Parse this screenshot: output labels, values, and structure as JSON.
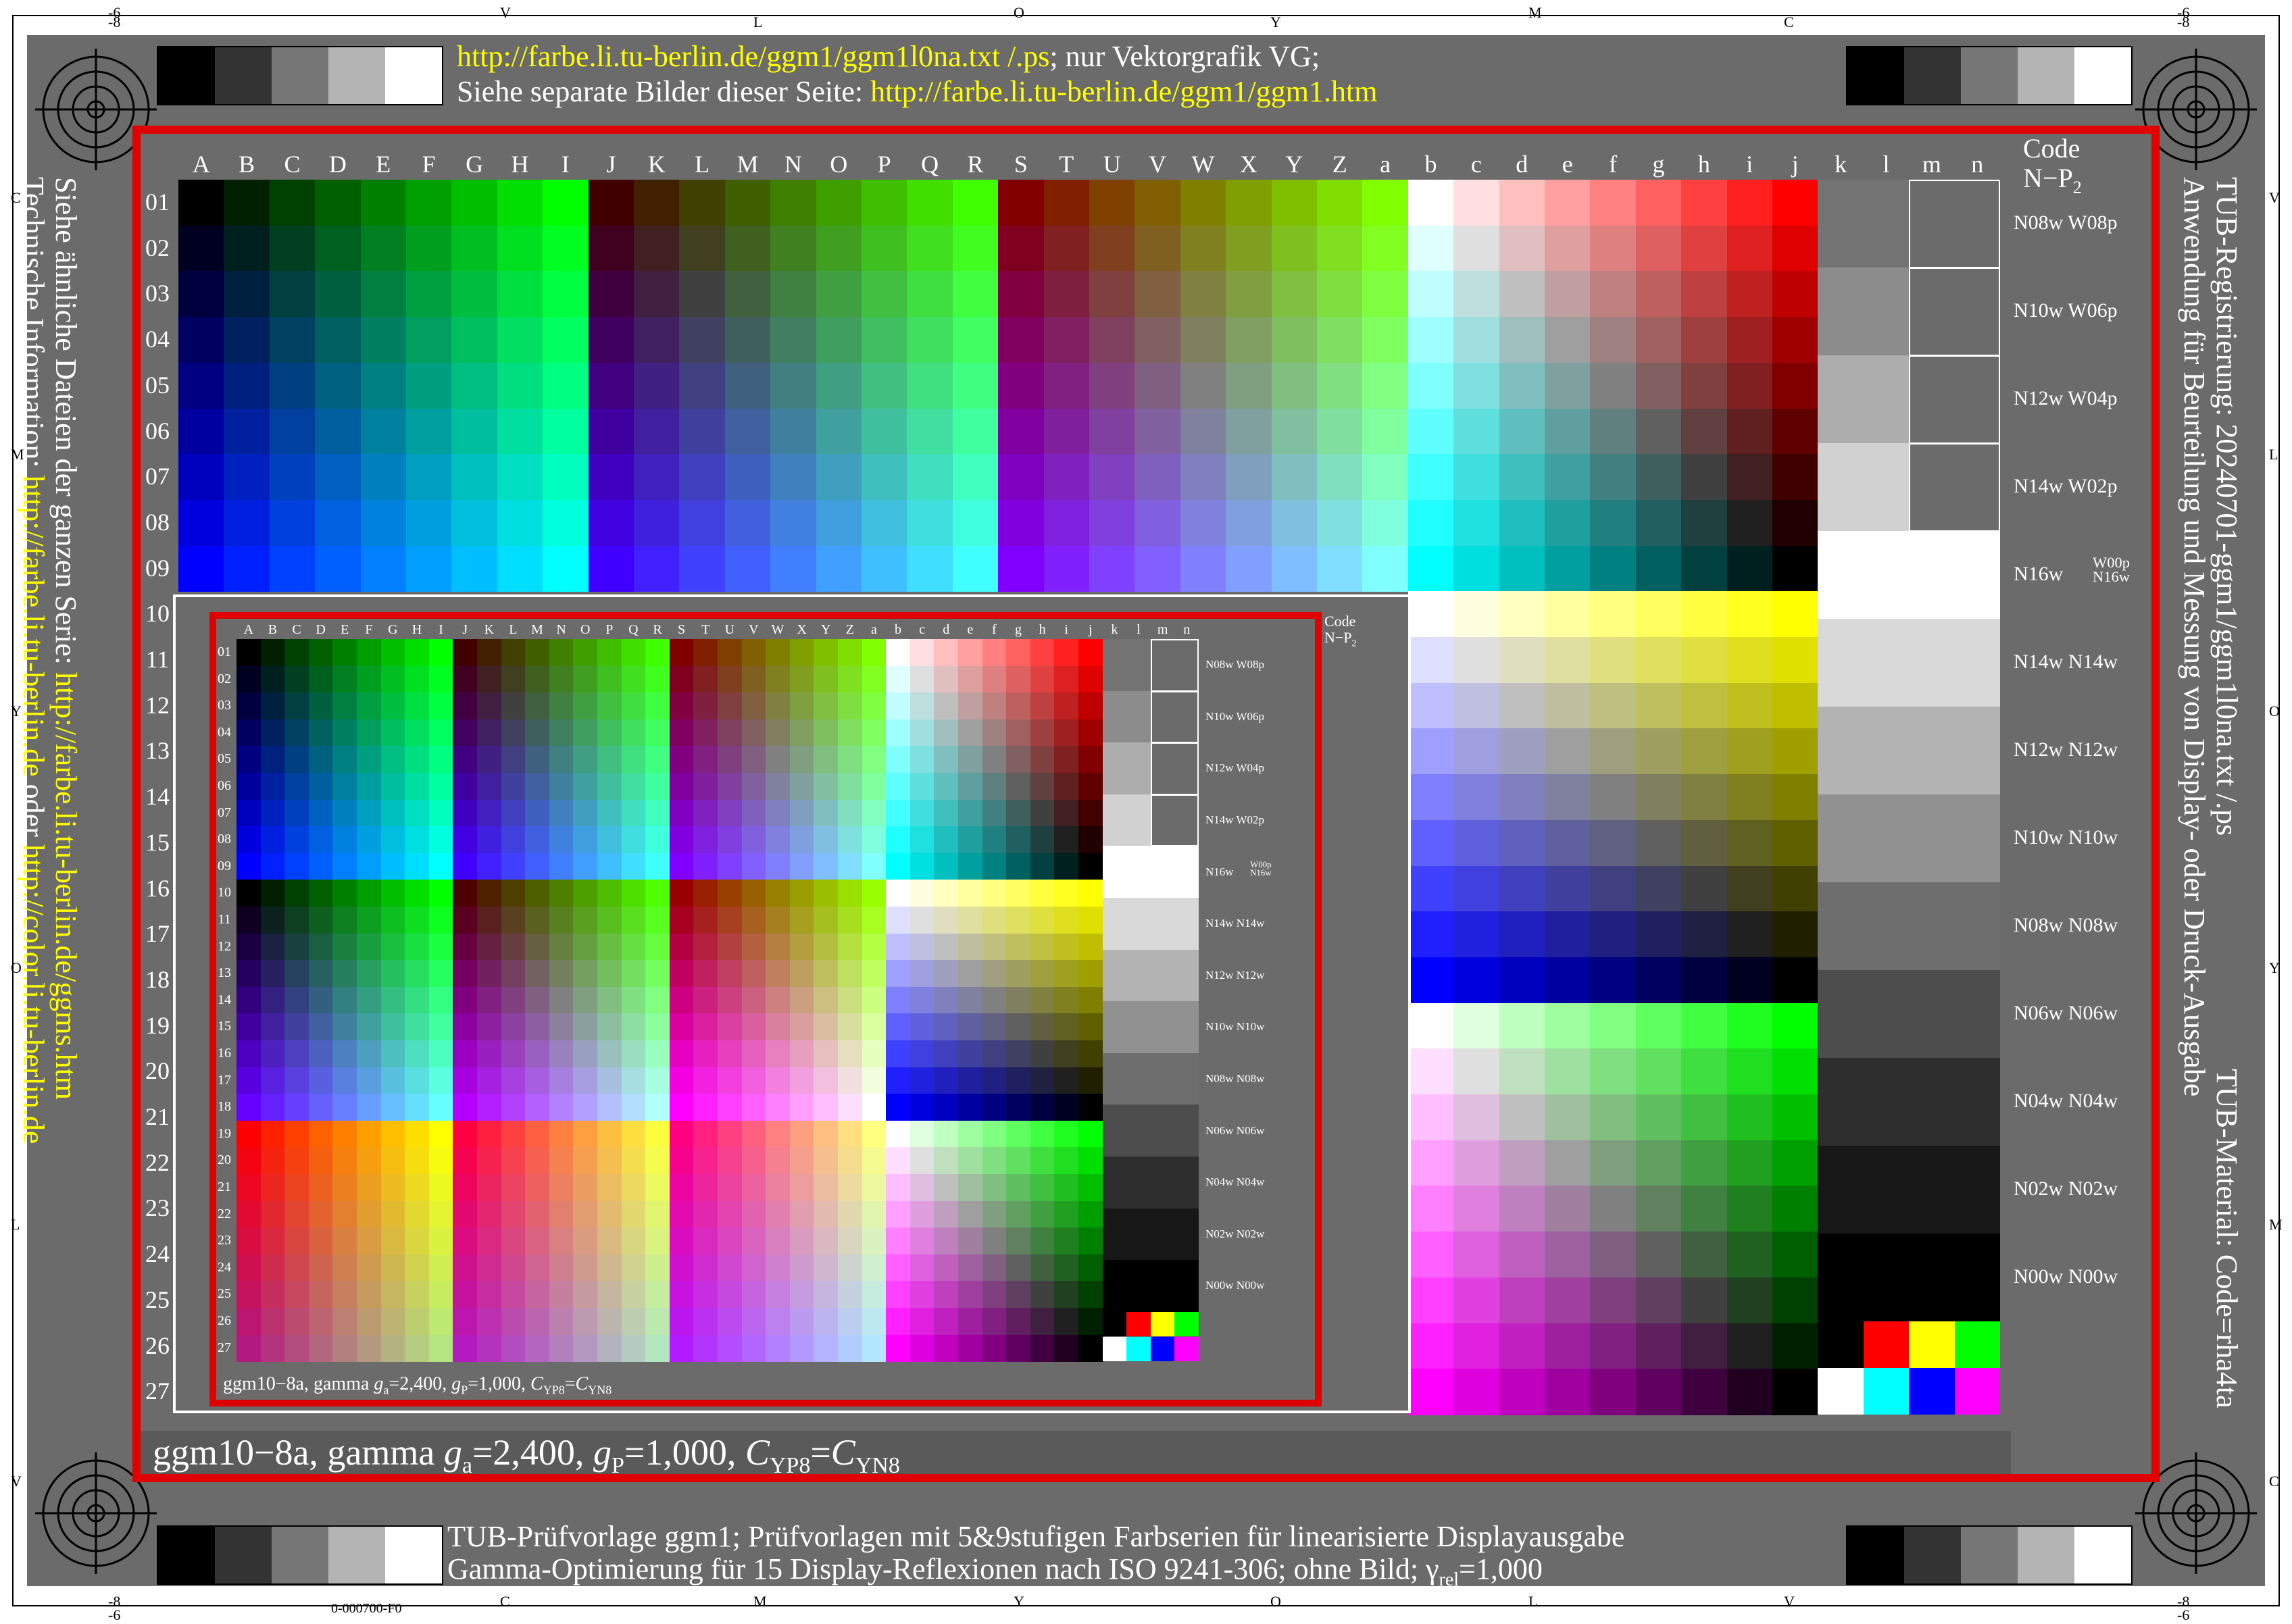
{
  "page": {
    "frame_code": "0-000700-F0"
  },
  "edge_markers": {
    "top": [
      "-6",
      "-8",
      "V",
      "L",
      "O",
      "Y",
      "M",
      "C",
      "-8",
      "-6"
    ],
    "bottom": [
      "-6",
      "-8",
      "C",
      "M",
      "Y",
      "O",
      "L",
      "V",
      "-8",
      "-6"
    ],
    "left": [
      "C",
      "M",
      "Y",
      "O",
      "L",
      "V"
    ],
    "right": [
      "V",
      "L",
      "O",
      "Y",
      "M",
      "C"
    ]
  },
  "header": {
    "line1_link": "http://farbe.li.tu-berlin.de/ggm1/ggm1l0na.txt /.ps",
    "line1_text": "; nur Vektorgrafik VG;",
    "line2_text": "Siehe separate Bilder dieser Seite: ",
    "line2_link": "http://farbe.li.tu-berlin.de/ggm1/ggm1.htm"
  },
  "footer": {
    "line1": "TUB-Prüfvorlage ggm1; Prüfvorlagen mit 5&9stufigen Farbserien für linearisierte Displayausgabe",
    "line2_main": "Gamma-Optimierung für 15 Display-Reflexionen nach ISO 9241-306; ohne Bild; γ",
    "line2_sub": "rel",
    "line2_end": "=1,000"
  },
  "left_side": {
    "line1_text": "Siehe ähnliche Dateien der ganzen Serie: ",
    "line1_link": "http://farbe.li.tu-berlin.de/ggms.htm",
    "line2_text": "Technische Information: ",
    "line2_link1": "http://farbe.li.tu-berlin.de",
    "line2_mid": " oder ",
    "line2_link2": "http://color.li.tu-berlin.de"
  },
  "right_side": {
    "line1": "TUB-Registrierung: 20240701-ggm1/ggm1l0na.txt /.ps",
    "line2": "Anwendung für Beurteilung und Messung von Display- oder Druck-Ausgabe",
    "line3": "TUB-Material: Code=rha4ta"
  },
  "chart": {
    "columns": [
      "A",
      "B",
      "C",
      "D",
      "E",
      "F",
      "G",
      "H",
      "I",
      "J",
      "K",
      "L",
      "M",
      "N",
      "O",
      "P",
      "Q",
      "R",
      "S",
      "T",
      "U",
      "V",
      "W",
      "X",
      "Y",
      "Z",
      "a",
      "b",
      "c",
      "d",
      "e",
      "f",
      "g",
      "h",
      "i",
      "j",
      "k",
      "l",
      "m",
      "n"
    ],
    "rows": [
      "01",
      "02",
      "03",
      "04",
      "05",
      "06",
      "07",
      "08",
      "09",
      "10",
      "11",
      "12",
      "13",
      "14",
      "15",
      "16",
      "17",
      "18",
      "19",
      "20",
      "21",
      "22",
      "23",
      "24",
      "25",
      "26",
      "27"
    ],
    "code_header": "Code",
    "code_header2": "N−P",
    "code_header2_sub": "2",
    "code_labels": [
      "N08w  W08p",
      "N10w  W06p",
      "N12w  W04p",
      "N14w  W02p",
      "N16w",
      "N14w  N14w",
      "N12w  N12w",
      "N10w  N10w",
      "N08w  N08w",
      "N06w  N06w",
      "N04w  N04w",
      "N02w  N02w",
      "N00w  N00w"
    ],
    "w00p_top": "W00p",
    "w00p_bot": "N16w",
    "caption_main": "ggm10−8a, gamma ",
    "caption_ga": "g",
    "caption_ga_sub": "a",
    "caption_mid": "=2,400, ",
    "caption_gp": "g",
    "caption_gp_sub": "P",
    "caption_mid2": "=1,000, ",
    "caption_c1": "C",
    "caption_c1_sub": "YP8",
    "caption_eq": "=",
    "caption_c2": "C",
    "caption_c2_sub": "YN8"
  }
}
